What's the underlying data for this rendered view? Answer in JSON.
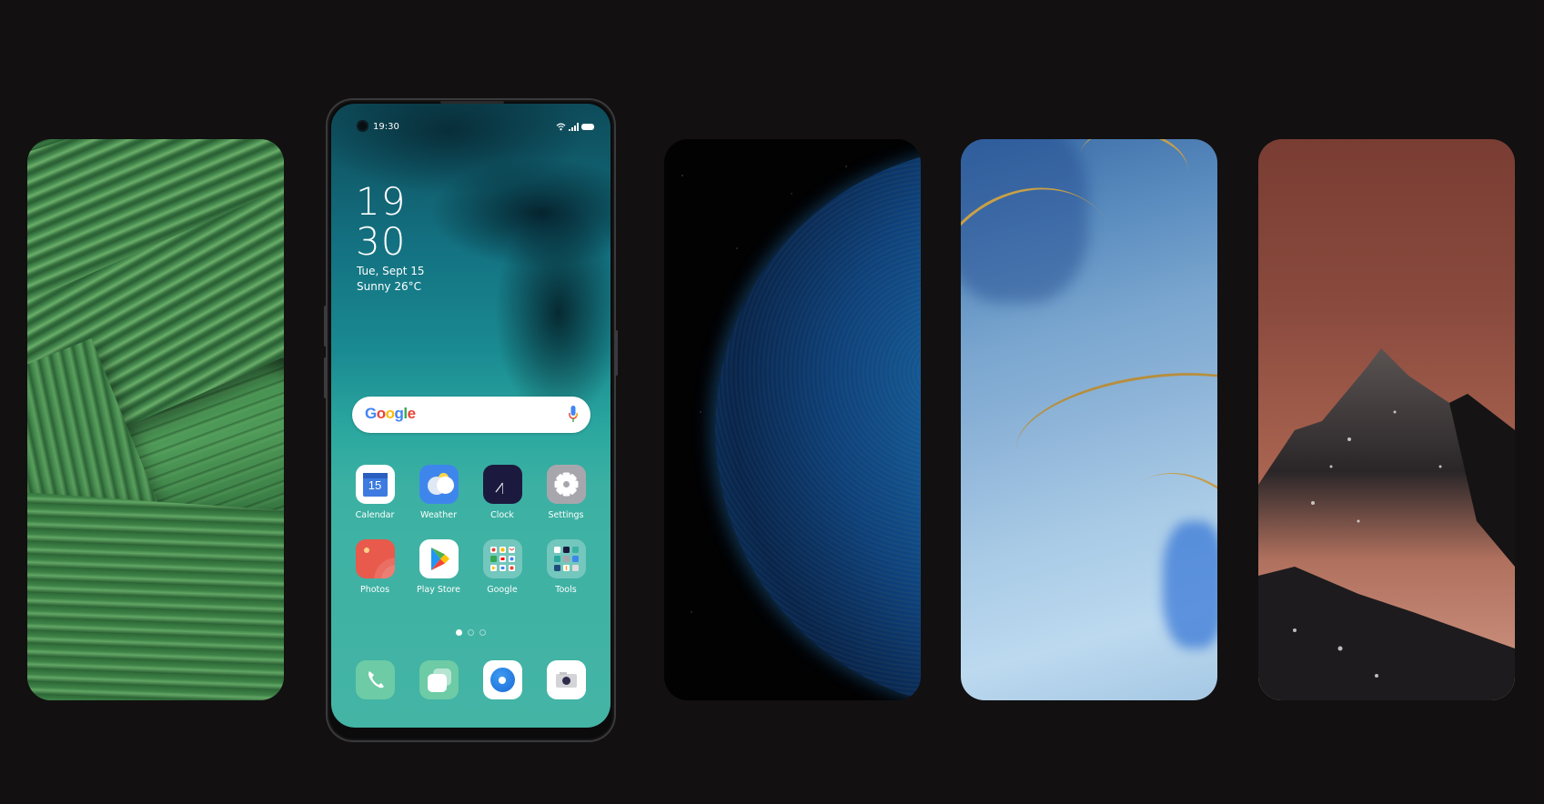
{
  "wallpapers": [
    {
      "name": "green-leaves",
      "accent": "#3f8a4a"
    },
    {
      "name": "blue-planet",
      "accent": "#145f9e"
    },
    {
      "name": "blue-marble",
      "accent": "#8fb5d9"
    },
    {
      "name": "red-mountain",
      "accent": "#a5604d"
    }
  ],
  "phone": {
    "status_bar": {
      "time": "19:30",
      "icons": [
        "wifi-icon",
        "signal-icon",
        "battery-icon"
      ]
    },
    "clock": {
      "hour": "19",
      "minute": "30"
    },
    "date": "Tue, Sept 15",
    "weather": "Sunny 26°C",
    "search": {
      "logo": "Google",
      "icon": "mic-icon"
    },
    "apps_row1": [
      {
        "label": "Calendar",
        "icon": "calendar-icon",
        "badge": "15"
      },
      {
        "label": "Weather",
        "icon": "weather-icon"
      },
      {
        "label": "Clock",
        "icon": "clock-icon"
      },
      {
        "label": "Settings",
        "icon": "gear-icon"
      }
    ],
    "apps_row2": [
      {
        "label": "Photos",
        "icon": "photos-icon"
      },
      {
        "label": "Play Store",
        "icon": "play-store-icon"
      },
      {
        "label": "Google",
        "icon": "folder-icon"
      },
      {
        "label": "Tools",
        "icon": "folder-icon"
      }
    ],
    "page_indicator": {
      "pages": 3,
      "current": 1
    },
    "dock": [
      {
        "name": "phone",
        "icon": "phone-icon"
      },
      {
        "name": "messages",
        "icon": "messages-icon"
      },
      {
        "name": "browser",
        "icon": "browser-icon"
      },
      {
        "name": "camera",
        "icon": "camera-icon"
      }
    ]
  },
  "colors": {
    "background": "#121011",
    "screen_teal": "#3cb1a3"
  }
}
